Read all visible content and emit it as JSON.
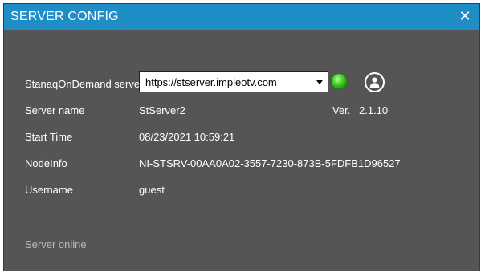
{
  "window": {
    "title": "SERVER CONFIG",
    "close_glyph": "✕",
    "titlebar_color": "#1f8dc6",
    "background_color": "#555555"
  },
  "fields": {
    "server_label": "StanaqOnDemand server",
    "server_url": "https://stserver.impleotv.com",
    "server_name_label": "Server name",
    "server_name_value": "StServer2",
    "version_label": "Ver.",
    "version_value": "2.1.10",
    "start_time_label": "Start Time",
    "start_time_value": "08/23/2021 10:59:21",
    "nodeinfo_label": "NodeInfo",
    "nodeinfo_value": "NI-STSRV-00AA0A02-3557-7230-873B-5FDFB1D96527",
    "username_label": "Username",
    "username_value": "guest"
  },
  "icons": {
    "close": "close-icon",
    "dropdown": "chevron-down-icon",
    "status": "status-led-icon",
    "user": "user-icon"
  },
  "status": {
    "led_color": "#49d62a",
    "text": "Server online"
  }
}
